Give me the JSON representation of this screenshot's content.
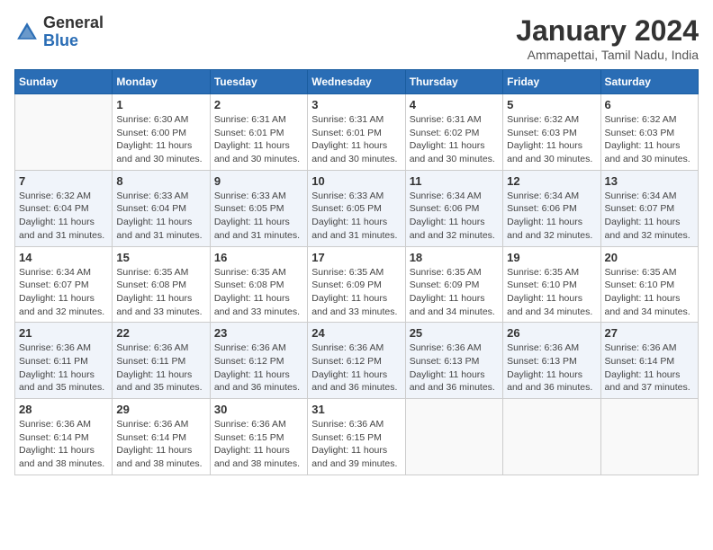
{
  "header": {
    "logo": {
      "general": "General",
      "blue": "Blue"
    },
    "title": "January 2024",
    "subtitle": "Ammapettai, Tamil Nadu, India"
  },
  "calendar": {
    "days_of_week": [
      "Sunday",
      "Monday",
      "Tuesday",
      "Wednesday",
      "Thursday",
      "Friday",
      "Saturday"
    ],
    "weeks": [
      [
        {
          "day": "",
          "sunrise": "",
          "sunset": "",
          "daylight": ""
        },
        {
          "day": "1",
          "sunrise": "Sunrise: 6:30 AM",
          "sunset": "Sunset: 6:00 PM",
          "daylight": "Daylight: 11 hours and 30 minutes."
        },
        {
          "day": "2",
          "sunrise": "Sunrise: 6:31 AM",
          "sunset": "Sunset: 6:01 PM",
          "daylight": "Daylight: 11 hours and 30 minutes."
        },
        {
          "day": "3",
          "sunrise": "Sunrise: 6:31 AM",
          "sunset": "Sunset: 6:01 PM",
          "daylight": "Daylight: 11 hours and 30 minutes."
        },
        {
          "day": "4",
          "sunrise": "Sunrise: 6:31 AM",
          "sunset": "Sunset: 6:02 PM",
          "daylight": "Daylight: 11 hours and 30 minutes."
        },
        {
          "day": "5",
          "sunrise": "Sunrise: 6:32 AM",
          "sunset": "Sunset: 6:03 PM",
          "daylight": "Daylight: 11 hours and 30 minutes."
        },
        {
          "day": "6",
          "sunrise": "Sunrise: 6:32 AM",
          "sunset": "Sunset: 6:03 PM",
          "daylight": "Daylight: 11 hours and 30 minutes."
        }
      ],
      [
        {
          "day": "7",
          "sunrise": "Sunrise: 6:32 AM",
          "sunset": "Sunset: 6:04 PM",
          "daylight": "Daylight: 11 hours and 31 minutes."
        },
        {
          "day": "8",
          "sunrise": "Sunrise: 6:33 AM",
          "sunset": "Sunset: 6:04 PM",
          "daylight": "Daylight: 11 hours and 31 minutes."
        },
        {
          "day": "9",
          "sunrise": "Sunrise: 6:33 AM",
          "sunset": "Sunset: 6:05 PM",
          "daylight": "Daylight: 11 hours and 31 minutes."
        },
        {
          "day": "10",
          "sunrise": "Sunrise: 6:33 AM",
          "sunset": "Sunset: 6:05 PM",
          "daylight": "Daylight: 11 hours and 31 minutes."
        },
        {
          "day": "11",
          "sunrise": "Sunrise: 6:34 AM",
          "sunset": "Sunset: 6:06 PM",
          "daylight": "Daylight: 11 hours and 32 minutes."
        },
        {
          "day": "12",
          "sunrise": "Sunrise: 6:34 AM",
          "sunset": "Sunset: 6:06 PM",
          "daylight": "Daylight: 11 hours and 32 minutes."
        },
        {
          "day": "13",
          "sunrise": "Sunrise: 6:34 AM",
          "sunset": "Sunset: 6:07 PM",
          "daylight": "Daylight: 11 hours and 32 minutes."
        }
      ],
      [
        {
          "day": "14",
          "sunrise": "Sunrise: 6:34 AM",
          "sunset": "Sunset: 6:07 PM",
          "daylight": "Daylight: 11 hours and 32 minutes."
        },
        {
          "day": "15",
          "sunrise": "Sunrise: 6:35 AM",
          "sunset": "Sunset: 6:08 PM",
          "daylight": "Daylight: 11 hours and 33 minutes."
        },
        {
          "day": "16",
          "sunrise": "Sunrise: 6:35 AM",
          "sunset": "Sunset: 6:08 PM",
          "daylight": "Daylight: 11 hours and 33 minutes."
        },
        {
          "day": "17",
          "sunrise": "Sunrise: 6:35 AM",
          "sunset": "Sunset: 6:09 PM",
          "daylight": "Daylight: 11 hours and 33 minutes."
        },
        {
          "day": "18",
          "sunrise": "Sunrise: 6:35 AM",
          "sunset": "Sunset: 6:09 PM",
          "daylight": "Daylight: 11 hours and 34 minutes."
        },
        {
          "day": "19",
          "sunrise": "Sunrise: 6:35 AM",
          "sunset": "Sunset: 6:10 PM",
          "daylight": "Daylight: 11 hours and 34 minutes."
        },
        {
          "day": "20",
          "sunrise": "Sunrise: 6:35 AM",
          "sunset": "Sunset: 6:10 PM",
          "daylight": "Daylight: 11 hours and 34 minutes."
        }
      ],
      [
        {
          "day": "21",
          "sunrise": "Sunrise: 6:36 AM",
          "sunset": "Sunset: 6:11 PM",
          "daylight": "Daylight: 11 hours and 35 minutes."
        },
        {
          "day": "22",
          "sunrise": "Sunrise: 6:36 AM",
          "sunset": "Sunset: 6:11 PM",
          "daylight": "Daylight: 11 hours and 35 minutes."
        },
        {
          "day": "23",
          "sunrise": "Sunrise: 6:36 AM",
          "sunset": "Sunset: 6:12 PM",
          "daylight": "Daylight: 11 hours and 36 minutes."
        },
        {
          "day": "24",
          "sunrise": "Sunrise: 6:36 AM",
          "sunset": "Sunset: 6:12 PM",
          "daylight": "Daylight: 11 hours and 36 minutes."
        },
        {
          "day": "25",
          "sunrise": "Sunrise: 6:36 AM",
          "sunset": "Sunset: 6:13 PM",
          "daylight": "Daylight: 11 hours and 36 minutes."
        },
        {
          "day": "26",
          "sunrise": "Sunrise: 6:36 AM",
          "sunset": "Sunset: 6:13 PM",
          "daylight": "Daylight: 11 hours and 36 minutes."
        },
        {
          "day": "27",
          "sunrise": "Sunrise: 6:36 AM",
          "sunset": "Sunset: 6:14 PM",
          "daylight": "Daylight: 11 hours and 37 minutes."
        }
      ],
      [
        {
          "day": "28",
          "sunrise": "Sunrise: 6:36 AM",
          "sunset": "Sunset: 6:14 PM",
          "daylight": "Daylight: 11 hours and 38 minutes."
        },
        {
          "day": "29",
          "sunrise": "Sunrise: 6:36 AM",
          "sunset": "Sunset: 6:14 PM",
          "daylight": "Daylight: 11 hours and 38 minutes."
        },
        {
          "day": "30",
          "sunrise": "Sunrise: 6:36 AM",
          "sunset": "Sunset: 6:15 PM",
          "daylight": "Daylight: 11 hours and 38 minutes."
        },
        {
          "day": "31",
          "sunrise": "Sunrise: 6:36 AM",
          "sunset": "Sunset: 6:15 PM",
          "daylight": "Daylight: 11 hours and 39 minutes."
        },
        {
          "day": "",
          "sunrise": "",
          "sunset": "",
          "daylight": ""
        },
        {
          "day": "",
          "sunrise": "",
          "sunset": "",
          "daylight": ""
        },
        {
          "day": "",
          "sunrise": "",
          "sunset": "",
          "daylight": ""
        }
      ]
    ]
  }
}
